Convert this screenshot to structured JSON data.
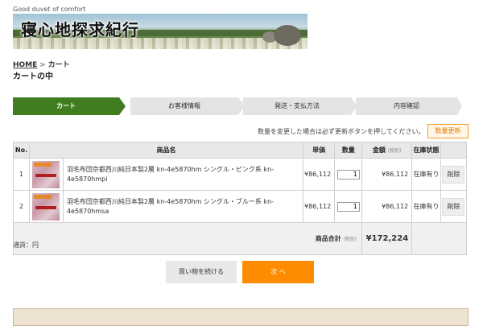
{
  "header": {
    "tagline": "Good duvet of comfort",
    "logo_title": "寝心地探求紀行"
  },
  "breadcrumb": {
    "home": "HOME",
    "sep": ">",
    "current": "カート"
  },
  "page_title": "カートの中",
  "steps": [
    "カート",
    "お客様情報",
    "発送・支払方法",
    "内容確認"
  ],
  "active_step": 0,
  "update_note": "数量を変更した場合は必ず更新ボタンを押してください。",
  "update_button": "数量更新",
  "table": {
    "headers": {
      "no": "No.",
      "name": "商品名",
      "price": "単価",
      "qty": "数量",
      "amount": "金額",
      "amount_note": "(税別)",
      "stock": "在庫状態"
    },
    "rows": [
      {
        "no": "1",
        "name": "羽毛布団京都西川純日本製2層 kn-4e5870hm シングル・ピンク系 kn-4e5870hmpi",
        "price": "¥86,112",
        "qty": "1",
        "amount": "¥86,112",
        "stock": "在庫有り",
        "delete": "削除"
      },
      {
        "no": "2",
        "name": "羽毛布団京都西川純日本製2層 kn-4e5870hm シングル・ブルー系 kn-4e5870hmsa",
        "price": "¥86,112",
        "qty": "1",
        "amount": "¥86,112",
        "stock": "在庫有り",
        "delete": "削除"
      }
    ],
    "total_label": "商品合計",
    "total_note": "(税別)",
    "total_value": "¥172,224"
  },
  "currency_note": "通貨：円",
  "buttons": {
    "continue": "買い物を続ける",
    "next": "次 へ"
  },
  "colors": {
    "active_step": "#3f7d1f",
    "next_button": "#ff8c00",
    "update_button_border": "#f0a030"
  }
}
